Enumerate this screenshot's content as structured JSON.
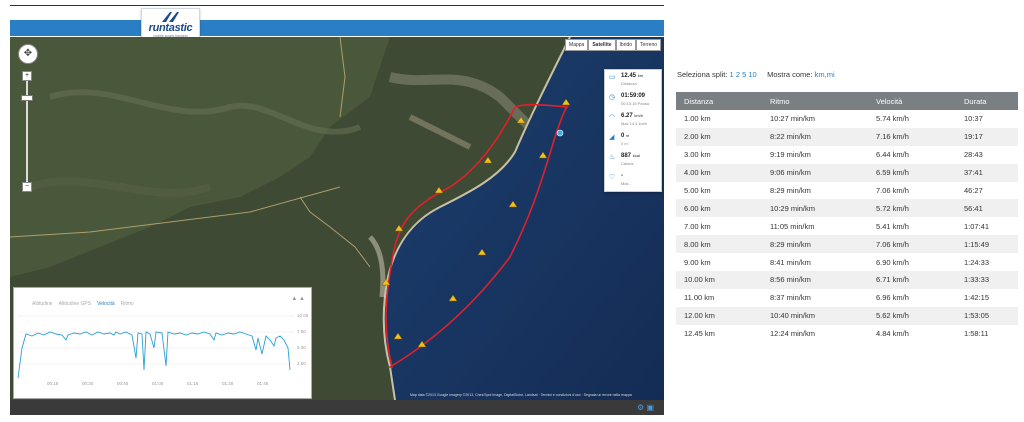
{
  "logo": {
    "brand": "runtastic",
    "tagline": "mobile sports tracking"
  },
  "map": {
    "type_buttons": [
      "Mappa",
      "Satellite",
      "Ibrido",
      "Terreno"
    ],
    "active_type": "Satellite",
    "zoom_in": "+",
    "zoom_out": "−",
    "copyright": "Map data ©2013 Google Imagery ©2013, Cnes/Spot Image, DigitalGlobe, Landsat · Termini e condizioni d'uso · Segnala un errore nella mappa",
    "route_color": "#e0202a"
  },
  "stats": [
    {
      "icon": "distance-icon",
      "glyph": "▭",
      "value": "12.45",
      "unit": "km",
      "label": "Distanza"
    },
    {
      "icon": "clock-icon",
      "glyph": "◷",
      "value": "01:59:09",
      "unit": "",
      "label": "00:13:18 Pausa"
    },
    {
      "icon": "speedometer-icon",
      "glyph": "◠",
      "value": "6.27",
      "unit": "km/h",
      "label": "Max 14.4 km/h"
    },
    {
      "icon": "elevation-icon",
      "glyph": "◢",
      "value": "0",
      "unit": "m",
      "label": "0 m"
    },
    {
      "icon": "flame-icon",
      "glyph": "♨",
      "value": "887",
      "unit": "kcal",
      "label": "Calorie"
    },
    {
      "icon": "heart-icon",
      "glyph": "♡",
      "value": "-",
      "unit": "",
      "label": "Max -"
    }
  ],
  "chart": {
    "legend": [
      "Altitudine",
      "Altitudine GPS",
      "Velocità",
      "Ritmo"
    ],
    "active_series": "Velocità",
    "series_color": "#2a9fd6",
    "y_ticks": [
      "10.00",
      "7.50",
      "5.00",
      "2.50"
    ],
    "x_ticks": [
      "00:15",
      "00:30",
      "00:45",
      "01:00",
      "01:15",
      "01:30",
      "01:45"
    ]
  },
  "split_selector": {
    "label": "Seleziona split:",
    "options": [
      "1",
      "2",
      "5",
      "10"
    ],
    "show_as_label": "Mostra come:",
    "show_as_options": [
      "km",
      "mi"
    ]
  },
  "table": {
    "headers": [
      "Distanza",
      "Ritmo",
      "Velocità",
      "Durata"
    ],
    "rows": [
      [
        "1.00 km",
        "10:27 min/km",
        "5.74 km/h",
        "10:37"
      ],
      [
        "2.00 km",
        "8:22 min/km",
        "7.16 km/h",
        "19:17"
      ],
      [
        "3.00 km",
        "9:19 min/km",
        "6.44 km/h",
        "28:43"
      ],
      [
        "4.00 km",
        "9:06 min/km",
        "6.59 km/h",
        "37:41"
      ],
      [
        "5.00 km",
        "8:29 min/km",
        "7.06 km/h",
        "46:27"
      ],
      [
        "6.00 km",
        "10:29 min/km",
        "5.72 km/h",
        "56:41"
      ],
      [
        "7.00 km",
        "11:05 min/km",
        "5.41 km/h",
        "1:07:41"
      ],
      [
        "8.00 km",
        "8:29 min/km",
        "7.06 km/h",
        "1:15:49"
      ],
      [
        "9.00 km",
        "8:41 min/km",
        "6.90 km/h",
        "1:24:33"
      ],
      [
        "10.00 km",
        "8:56 min/km",
        "6.71 km/h",
        "1:33:33"
      ],
      [
        "11.00 km",
        "8:37 min/km",
        "6.96 km/h",
        "1:42:15"
      ],
      [
        "12.00 km",
        "10:40 min/km",
        "5.62 km/h",
        "1:53:05"
      ],
      [
        "12.45 km",
        "12:24 min/km",
        "4.84 km/h",
        "1:58:11"
      ]
    ]
  }
}
